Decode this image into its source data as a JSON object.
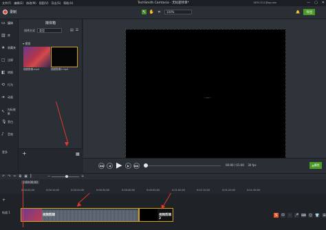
{
  "titlebar": {
    "menu": [
      "文件(F)",
      "编辑(E)",
      "修改(M)",
      "视图(V)",
      "导出(S)",
      "帮助(H)"
    ],
    "title": "TechSmith Camtasia - 无标题项目*",
    "account": "18911211@qq.com",
    "controls": [
      "—",
      "▢",
      "✕"
    ]
  },
  "toolbar": {
    "record_label": "录制",
    "zoom": "100%",
    "share_label": "导出"
  },
  "sidebar": {
    "items": [
      {
        "label": "媒体",
        "icon": "media-icon"
      },
      {
        "label": "库",
        "icon": "library-icon"
      },
      {
        "label": "收藏夹",
        "icon": "favorites-icon"
      },
      {
        "label": "注释",
        "icon": "annotation-icon"
      },
      {
        "label": "转换",
        "icon": "transition-icon"
      },
      {
        "label": "行为",
        "icon": "behavior-icon"
      },
      {
        "label": "动画",
        "icon": "animation-icon"
      },
      {
        "label": "光标效果",
        "icon": "cursor-effect-icon"
      },
      {
        "label": "旁白",
        "icon": "narration-icon"
      },
      {
        "label": "音效",
        "icon": "audio-effect-icon"
      }
    ],
    "more_label": "更多"
  },
  "bin": {
    "title": "媒体箱",
    "sort_label": "排序方式",
    "sort_value": "类型",
    "section_label": "视频",
    "items": [
      {
        "caption": "视频剪辑.mp4"
      },
      {
        "caption": "视频剪辑2.mp4"
      }
    ]
  },
  "playback": {
    "time": "00:00 / 01:00",
    "fps": "30 fps",
    "properties_label": "属性"
  },
  "timeline": {
    "playhead_time": "0:00:00;00",
    "ticks": [
      "0:00:00;00",
      "0:00:10;00",
      "0:00:20;00",
      "0:00:30;00",
      "0:00:40;00",
      "0:00:50;00",
      "0:01:00;00",
      "0:01:10;00",
      "0:01:20;00",
      "0:01:30;00"
    ],
    "track_label": "轨道 1",
    "clips": [
      {
        "label": "视频剪辑"
      },
      {
        "label": "视频剪辑2"
      }
    ]
  },
  "colors": {
    "accent_green": "#4c9a2a",
    "selection": "#d9a520",
    "playhead": "#d94141",
    "annotation_arrow": "#e23a2e"
  }
}
